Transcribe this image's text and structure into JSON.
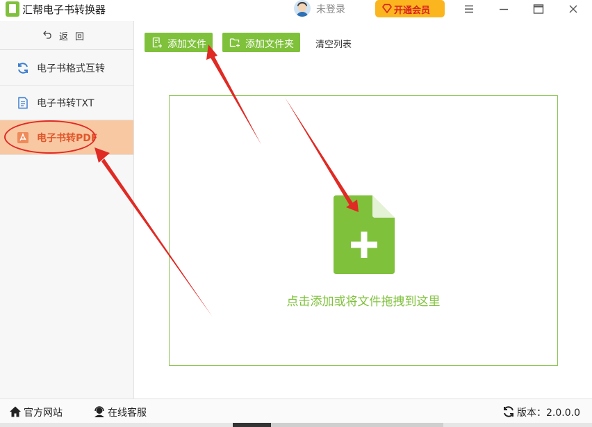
{
  "app": {
    "title": "汇帮电子书转换器"
  },
  "user": {
    "login_text": "未登录",
    "vip_label": "开通会员"
  },
  "window_controls": [
    "menu-icon",
    "minimize-icon",
    "maximize-icon",
    "close-icon"
  ],
  "sidebar": {
    "back_label": "返回",
    "items": [
      {
        "label": "电子书格式互转",
        "icon": "refresh-icon",
        "active": false
      },
      {
        "label": "电子书转TXT",
        "icon": "document-icon",
        "active": false
      },
      {
        "label": "电子书转PDF",
        "icon": "pdf-icon",
        "active": true
      }
    ]
  },
  "toolbar": {
    "add_file_label": "添加文件",
    "add_folder_label": "添加文件夹",
    "clear_label": "清空列表"
  },
  "drop_area": {
    "hint": "点击添加或将文件拖拽到这里"
  },
  "statusbar": {
    "website_label": "官方网站",
    "service_label": "在线客服",
    "version_label": "版本：2.0.0.0"
  },
  "colors": {
    "accent_green": "#7fc13b",
    "active_item_bg": "#f8c8a3",
    "vip_bg": "#fbb51e",
    "annotation_red": "#e02a24"
  }
}
